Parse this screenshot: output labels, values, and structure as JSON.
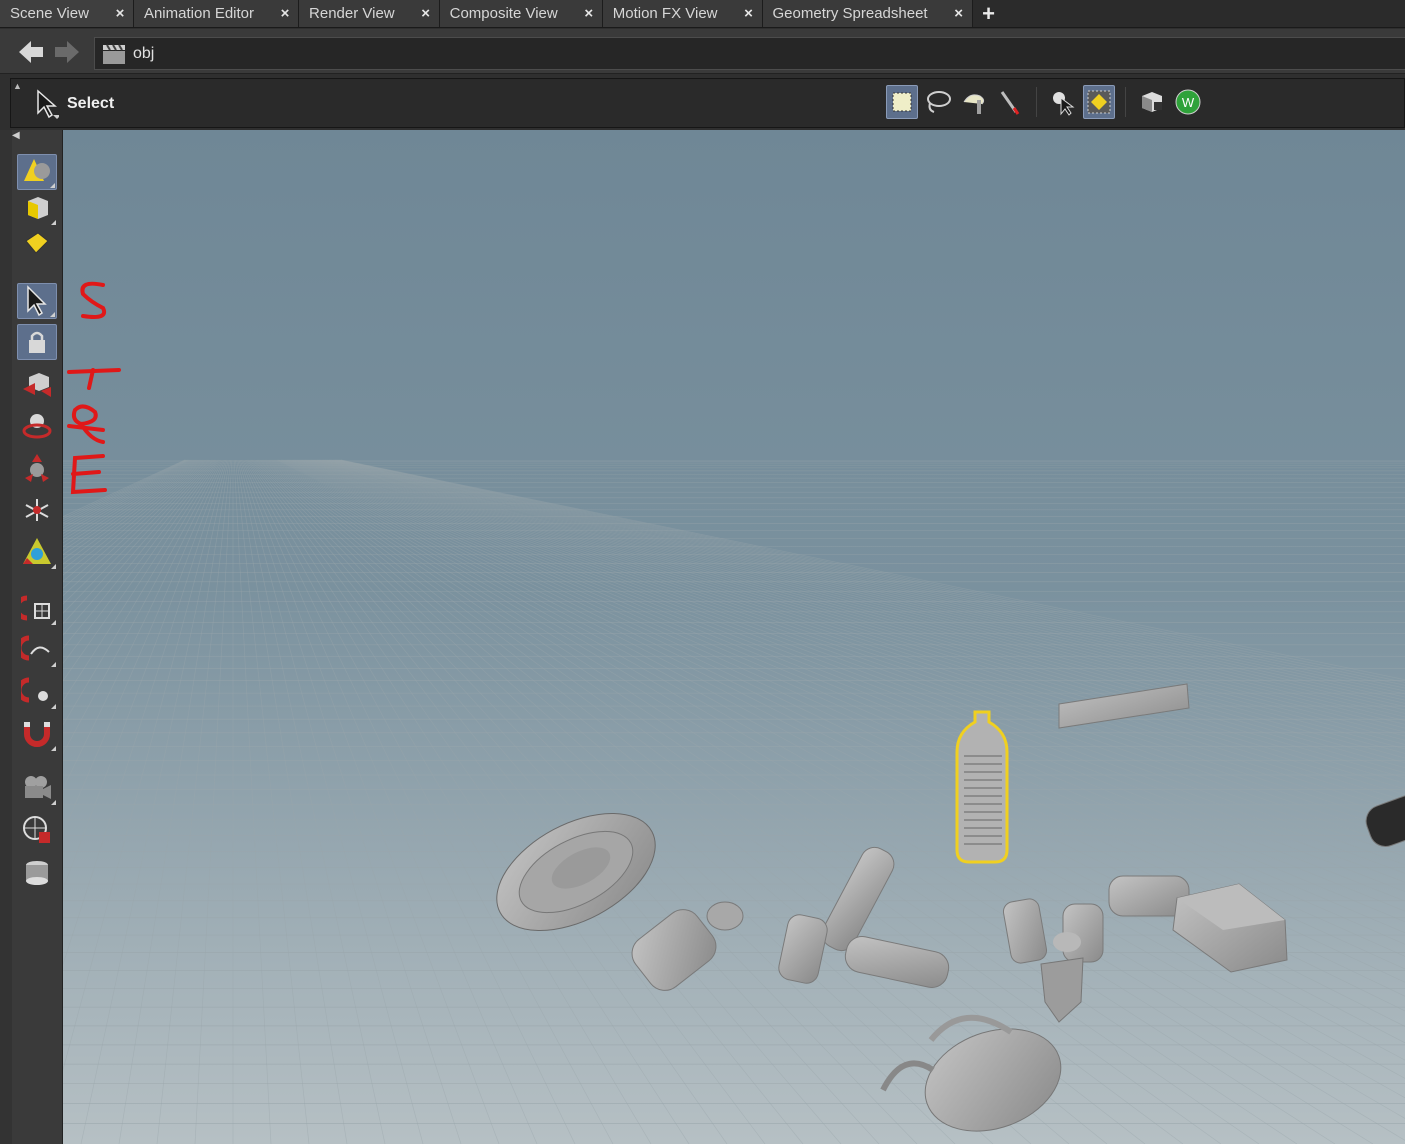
{
  "tabs": [
    {
      "label": "Scene View",
      "active": true
    },
    {
      "label": "Animation Editor",
      "active": false
    },
    {
      "label": "Render View",
      "active": false
    },
    {
      "label": "Composite View",
      "active": false
    },
    {
      "label": "Motion FX View",
      "active": false
    },
    {
      "label": "Geometry Spreadsheet",
      "active": false
    }
  ],
  "path": {
    "value": "obj"
  },
  "toolbar": {
    "select_label": "Select"
  },
  "annotation": {
    "letters": [
      "S",
      "T",
      "R",
      "E"
    ],
    "color": "#e01818"
  },
  "colors": {
    "accent": "#5d6f8c",
    "selection_highlight": "#f0d020",
    "viewport_top": "#6f8796",
    "viewport_bottom": "#b6c0c4"
  }
}
